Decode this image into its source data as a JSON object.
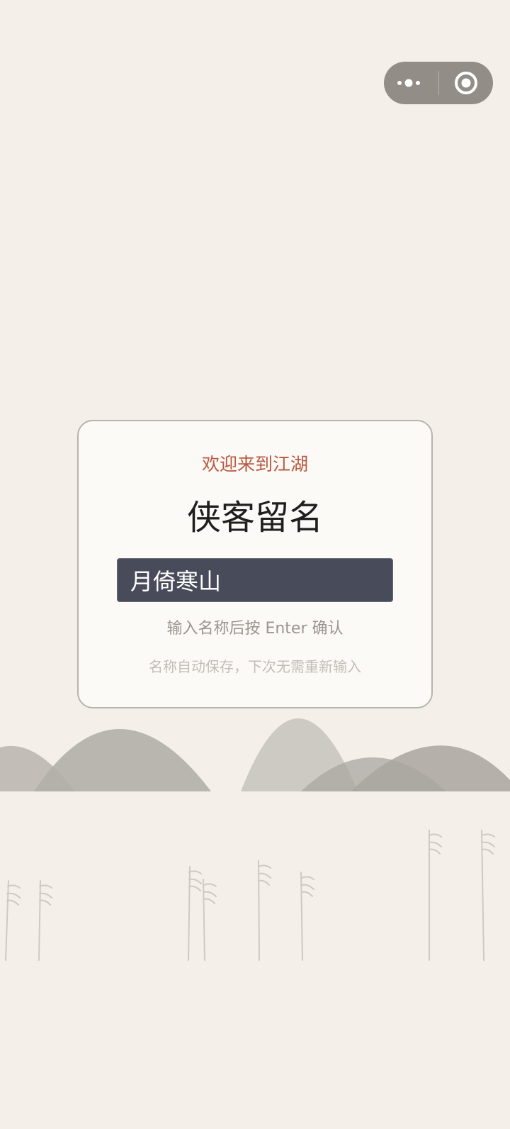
{
  "capsule": {
    "more_icon": "more-dots-icon",
    "close_icon": "target-close-icon"
  },
  "card": {
    "welcome": "欢迎来到江湖",
    "title": "侠客留名",
    "name_input_value": "月倚寒山",
    "hint": "输入名称后按 Enter 确认",
    "subhint": "名称自动保存，下次无需重新输入"
  },
  "colors": {
    "background": "#f4f0e9",
    "card": "#fcfaf6",
    "accent": "#b9573f",
    "input": "#484b59"
  }
}
